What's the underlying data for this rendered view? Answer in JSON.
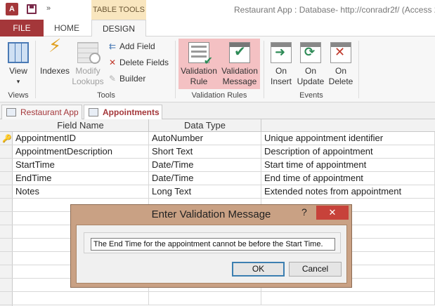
{
  "titlebar": {
    "app_icon_text": "A",
    "context_tab_header": "TABLE TOOLS",
    "window_title": "Restaurant App : Database- http://conradr2f/ (Access 2"
  },
  "tabs": {
    "file": "FILE",
    "home": "HOME",
    "design": "DESIGN"
  },
  "ribbon": {
    "view": {
      "line1": "View",
      "line2": "▾"
    },
    "indexes": "Indexes",
    "modify_lookups": {
      "line1": "Modify",
      "line2": "Lookups"
    },
    "add_field": "Add Field",
    "delete_fields": "Delete Fields",
    "builder": "Builder",
    "validation_rule": {
      "line1": "Validation",
      "line2": "Rule"
    },
    "validation_message": {
      "line1": "Validation",
      "line2": "Message"
    },
    "on_insert": {
      "line1": "On",
      "line2": "Insert"
    },
    "on_update": {
      "line1": "On",
      "line2": "Update"
    },
    "on_delete": {
      "line1": "On",
      "line2": "Delete"
    },
    "groups": {
      "views": "Views",
      "tools": "Tools",
      "validation_rules": "Validation Rules",
      "events": "Events"
    }
  },
  "doc_tabs": [
    {
      "label": "Restaurant App"
    },
    {
      "label": "Appointments"
    }
  ],
  "grid": {
    "headers": {
      "field_name": "Field Name",
      "data_type": "Data Type"
    },
    "rows": [
      {
        "field": "AppointmentID",
        "type": "AutoNumber",
        "desc": "Unique appointment identifier"
      },
      {
        "field": "AppointmentDescription",
        "type": "Short Text",
        "desc": "Description of appointment"
      },
      {
        "field": "StartTime",
        "type": "Date/Time",
        "desc": "Start time of appointment"
      },
      {
        "field": "EndTime",
        "type": "Date/Time",
        "desc": "End time of appointment"
      },
      {
        "field": "Notes",
        "type": "Long Text",
        "desc": "Extended notes from appointment"
      }
    ]
  },
  "dialog": {
    "title": "Enter Validation Message",
    "help": "?",
    "close": "✕",
    "message_value": "The End Time for the appointment cannot be before the Start Time.",
    "ok": "OK",
    "cancel": "Cancel"
  }
}
